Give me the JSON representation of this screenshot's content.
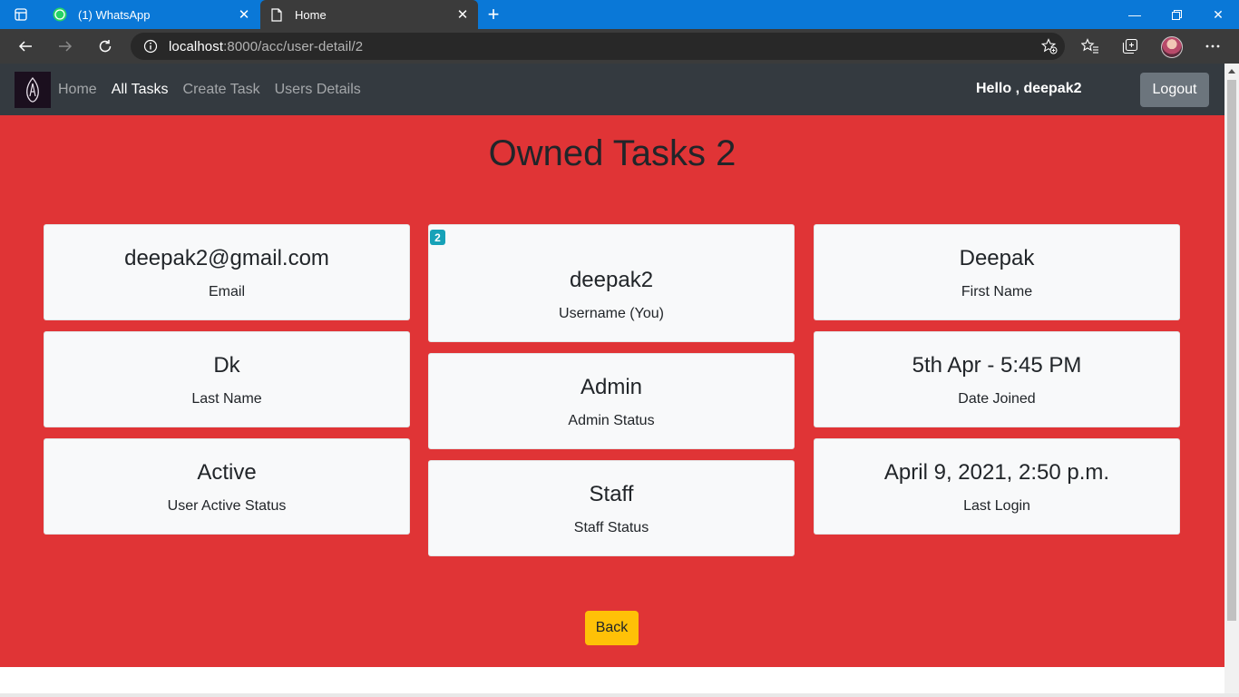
{
  "browser": {
    "tabs": [
      {
        "title": "(1) WhatsApp",
        "icon": "whatsapp-icon",
        "badge": "1"
      },
      {
        "title": "Home",
        "icon": "page-icon"
      }
    ],
    "url_host": "localhost",
    "url_path": ":8000/acc/user-detail/2"
  },
  "navbar": {
    "links": [
      "Home",
      "All Tasks",
      "Create Task",
      "Users Details"
    ],
    "active_link": "All Tasks",
    "greeting": "Hello , deepak2",
    "logout_label": "Logout"
  },
  "main": {
    "title": "Owned Tasks 2",
    "cards": {
      "email": {
        "value": "deepak2@gmail.com",
        "label": "Email"
      },
      "last_name": {
        "value": "Dk",
        "label": "Last Name"
      },
      "active": {
        "value": "Active",
        "label": "User Active Status"
      },
      "username": {
        "value": "deepak2",
        "label": "Username (You)",
        "badge": "2"
      },
      "admin": {
        "value": "Admin",
        "label": "Admin Status"
      },
      "staff": {
        "value": "Staff",
        "label": "Staff Status"
      },
      "first_name": {
        "value": "Deepak",
        "label": "First Name"
      },
      "date_joined": {
        "value": "5th Apr - 5:45 PM",
        "label": "Date Joined"
      },
      "last_login": {
        "value": "April 9, 2021, 2:50 p.m.",
        "label": "Last Login"
      }
    },
    "back_label": "Back"
  },
  "colors": {
    "content_bg": "#e03436",
    "navbar_bg": "#343a40",
    "card_bg": "#f8f9fa",
    "badge_bg": "#17a2b8",
    "back_btn_bg": "#ffc107",
    "logout_btn_bg": "#6c757d"
  }
}
